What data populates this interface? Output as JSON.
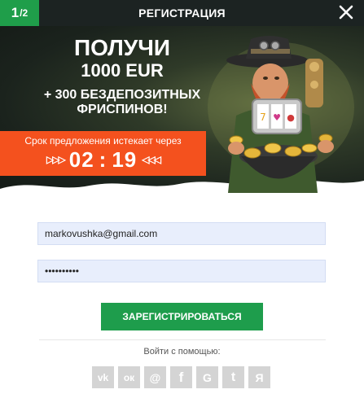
{
  "header": {
    "step_main": "1",
    "step_total": "/2",
    "title": "РЕГИСТРАЦИЯ"
  },
  "promo": {
    "line1": "ПОЛУЧИ",
    "line2": "1000 EUR",
    "line3": "+ 300 БЕЗДЕПОЗИТНЫХ",
    "line4": "ФРИСПИНОВ!",
    "offer_label": "Срок предложения истекает через",
    "timer_left_arrows": "▷▷▷",
    "timer_minutes": "02",
    "timer_sep": ":",
    "timer_seconds": "19",
    "timer_right_arrows": "◁◁◁"
  },
  "form": {
    "email_value": "markovushka@gmail.com",
    "password_value": "••••••••••",
    "submit_label": "ЗАРЕГИСТРИРОВАТЬСЯ",
    "login_with_label": "Войти с помощью:"
  },
  "social": [
    {
      "icon": "vk-icon",
      "glyph": "vk"
    },
    {
      "icon": "odnoklassniki-icon",
      "glyph": "ок"
    },
    {
      "icon": "mail-ru-icon",
      "glyph": "@"
    },
    {
      "icon": "facebook-icon",
      "glyph": "f"
    },
    {
      "icon": "google-icon",
      "glyph": "G"
    },
    {
      "icon": "twitter-icon",
      "glyph": "t"
    },
    {
      "icon": "yandex-icon",
      "glyph": "Я"
    }
  ],
  "colors": {
    "accent_green": "#1e9d4c",
    "offer_orange": "#f4511e",
    "header_dark": "#1c2322",
    "input_bg": "#e8eefc",
    "social_grey": "#d4d4d4"
  }
}
